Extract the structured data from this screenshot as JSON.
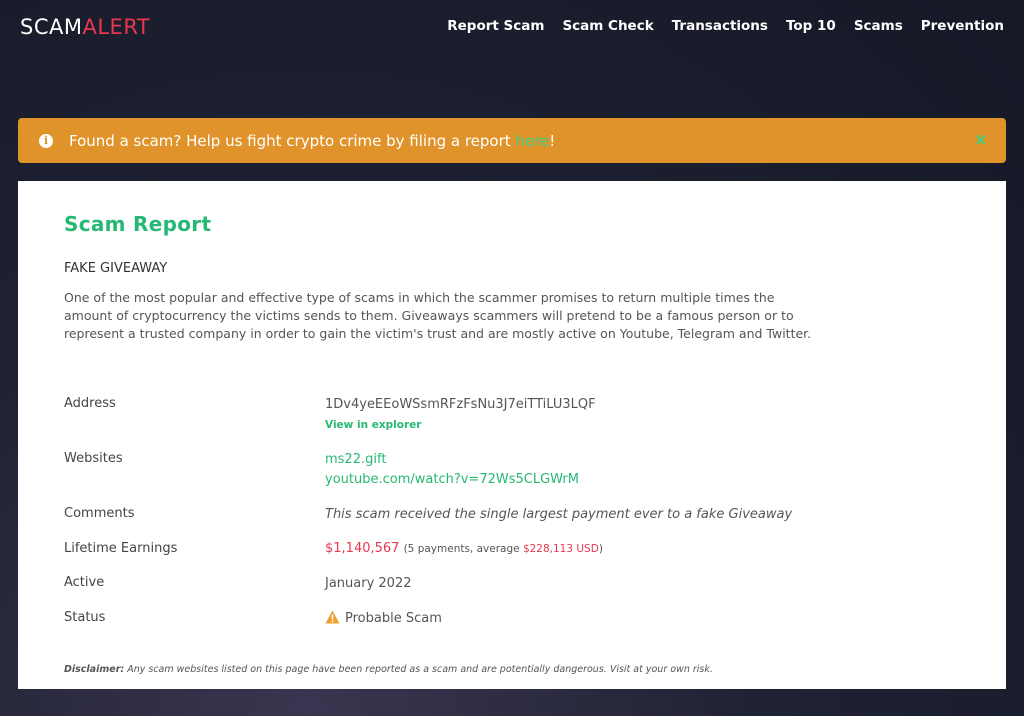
{
  "logo": {
    "part1": "SCAM",
    "part2": "ALERT"
  },
  "nav": [
    "Report Scam",
    "Scam Check",
    "Transactions",
    "Top 10",
    "Scams",
    "Prevention"
  ],
  "banner": {
    "text_before": "Found a scam? Help us fight crypto crime by filing a report ",
    "link": "here",
    "text_after": "!",
    "close": "×"
  },
  "report": {
    "title": "Scam Report",
    "type": "FAKE GIVEAWAY",
    "description": "One of the most popular and effective type of scams in which the scammer promises to return multiple times the amount of cryptocurrency the victims sends to them. Giveaways scammers will pretend to be a famous person or to represent a trusted company in order to gain the victim's trust and are mostly active on Youtube, Telegram and Twitter.",
    "address_label": "Address",
    "address": "1Dv4yeEEoWSsmRFzFsNu3J7eiTTiLU3LQF",
    "explorer_link": "View in explorer",
    "websites_label": "Websites",
    "websites": [
      "ms22.gift",
      "youtube.com/watch?v=72Ws5CLGWrM"
    ],
    "comments_label": "Comments",
    "comments": "This scam received the single largest payment ever to a fake Giveaway",
    "earnings_label": "Lifetime Earnings",
    "earnings_total": "$1,140,567",
    "earnings_detail_before": "(5 payments, average ",
    "earnings_average": "$228,113 USD",
    "earnings_detail_after": ")",
    "active_label": "Active",
    "active": "January 2022",
    "status_label": "Status",
    "status": "Probable Scam",
    "disclaimer_label": "Disclaimer:",
    "disclaimer": " Any scam websites listed on this page have been reported as a scam and are potentially dangerous. Visit at your own risk."
  },
  "colors": {
    "accent_green": "#27b873",
    "alert_red": "#e8384f",
    "banner_orange": "#e0932a",
    "warning_orange": "#f0a030"
  }
}
